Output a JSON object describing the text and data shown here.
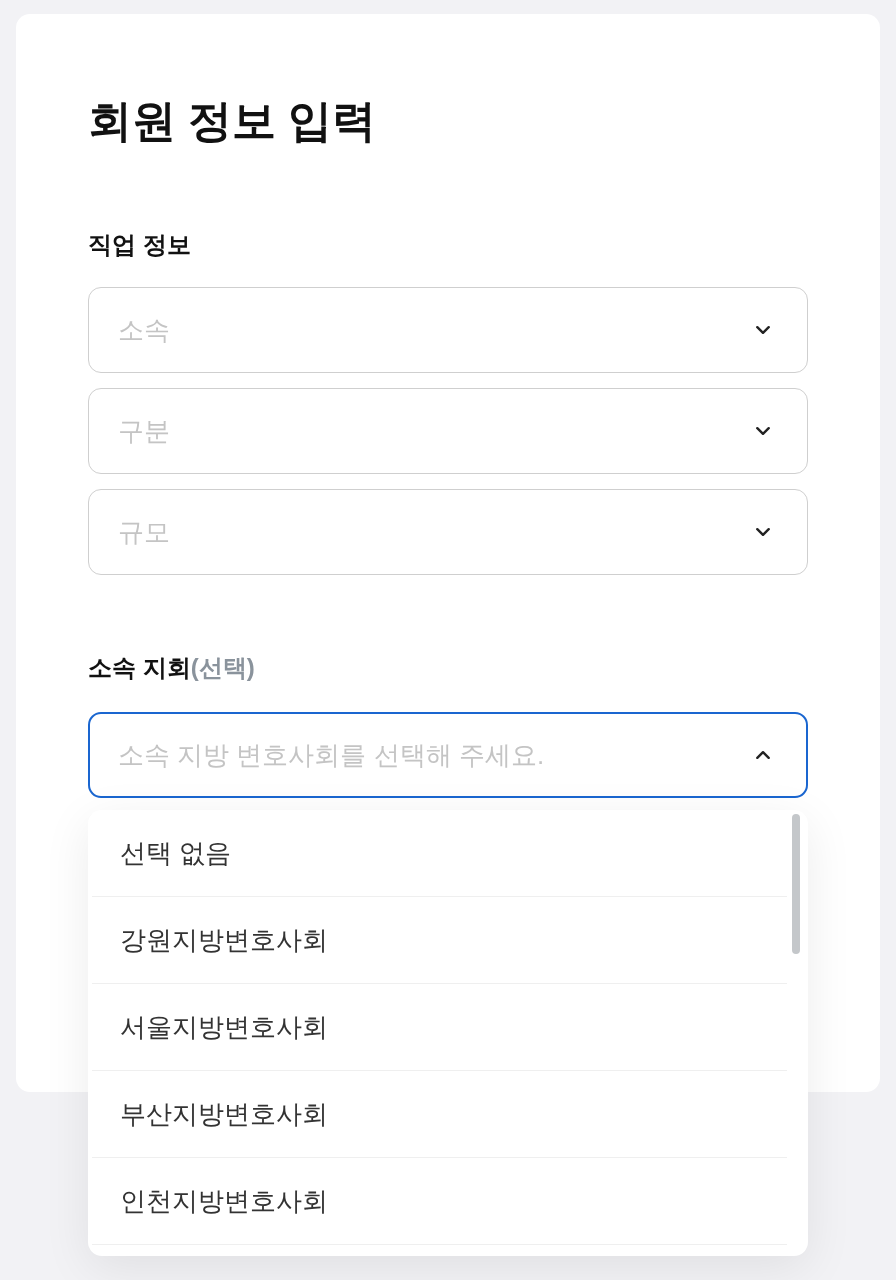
{
  "page": {
    "title": "회원 정보 입력"
  },
  "job_info": {
    "label": "직업 정보",
    "selects": [
      {
        "placeholder": "소속",
        "expanded": false
      },
      {
        "placeholder": "구분",
        "expanded": false
      },
      {
        "placeholder": "규모",
        "expanded": false
      }
    ]
  },
  "branch": {
    "label": "소속 지회",
    "optional_note": "(선택)",
    "select": {
      "placeholder": "소속 지방 변호사회를 선택해 주세요.",
      "expanded": true
    },
    "options": [
      {
        "label": "선택 없음",
        "selected": false
      },
      {
        "label": "강원지방변호사회",
        "selected": false
      },
      {
        "label": "서울지방변호사회",
        "selected": false
      },
      {
        "label": "부산지방변호사회",
        "selected": false
      },
      {
        "label": "인천지방변호사회",
        "selected": false
      }
    ]
  }
}
